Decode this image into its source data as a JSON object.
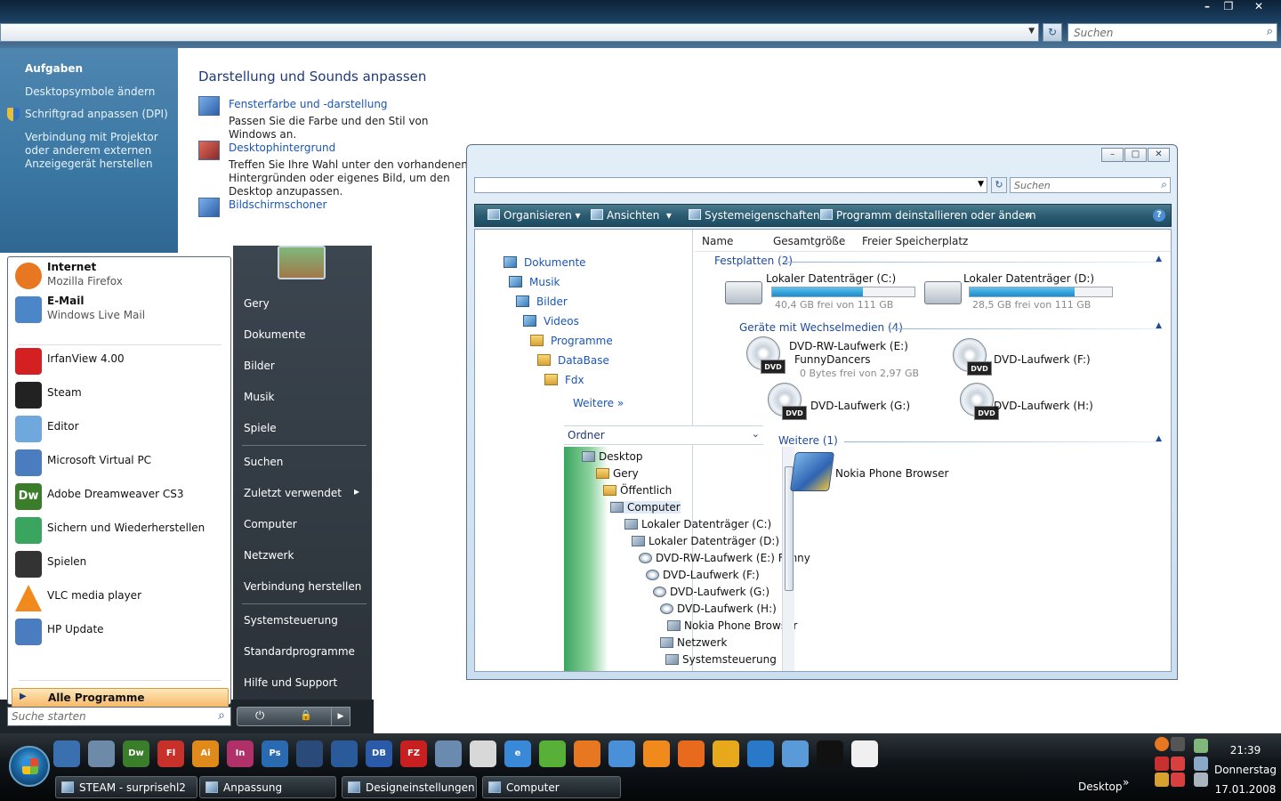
{
  "control_panel": {
    "search_placeholder": "Suchen",
    "window_buttons": {
      "minimize": "–",
      "maximize": "❐",
      "close": "✕"
    },
    "sidebar": {
      "heading": "Aufgaben",
      "links": [
        "Desktopsymbole ändern",
        "Schriftgrad anpassen (DPI)",
        "Verbindung mit Projektor oder anderem externen Anzeigegerät herstellen"
      ]
    },
    "title": "Darstellung und Sounds anpassen",
    "items": [
      {
        "link": "Fensterfarbe und -darstellung",
        "desc": "Passen Sie die Farbe und den Stil von Windows an."
      },
      {
        "link": "Desktophintergrund",
        "desc": "Treffen Sie Ihre Wahl unter den vorhandenen Hintergründen oder eigenes Bild, um den Desktop anzupassen."
      },
      {
        "link": "Bildschirmschoner",
        "desc": ""
      }
    ]
  },
  "explorer": {
    "search_placeholder": "Suchen",
    "toolbar": [
      "Organisieren",
      "Ansichten",
      "Systemeigenschaften",
      "Programm deinstallieren oder ändern"
    ],
    "toolbar_more": "»",
    "help": "?",
    "favorites": [
      "Dokumente",
      "Musik",
      "Bilder",
      "Videos",
      "Programme",
      "DataBase",
      "Fdx"
    ],
    "more_label": "Weitere",
    "more_chevron": "»",
    "folders_label": "Ordner",
    "tree": [
      "Desktop",
      "Gery",
      "Öffentlich",
      "Computer",
      "Lokaler Datenträger (C:)",
      "Lokaler Datenträger (D:)",
      "DVD-RW-Laufwerk (E:) Funny",
      "DVD-Laufwerk (F:)",
      "DVD-Laufwerk (G:)",
      "DVD-Laufwerk (H:)",
      "Nokia Phone Browser",
      "Netzwerk",
      "Systemsteuerung"
    ],
    "columns": [
      "Name",
      "Gesamtgröße",
      "Freier Speicherplatz"
    ],
    "groups": {
      "hdd": "Festplatten (2)",
      "removable": "Geräte mit Wechselmedien (4)",
      "other": "Weitere (1)"
    },
    "hdd": [
      {
        "name": "Lokaler Datenträger (C:)",
        "free": "40,4 GB frei von 111 GB",
        "used_fraction": 0.64
      },
      {
        "name": "Lokaler Datenträger (D:)",
        "free": "28,5 GB frei von 111 GB",
        "used_fraction": 0.74
      }
    ],
    "removable": [
      {
        "name": "DVD-RW-Laufwerk (E:)",
        "label": "FunnyDancers",
        "free": "0 Bytes frei von 2,97 GB"
      },
      {
        "name": "DVD-Laufwerk (F:)"
      },
      {
        "name": "DVD-Laufwerk (G:)"
      },
      {
        "name": "DVD-Laufwerk (H:)"
      }
    ],
    "dvd_badge": "DVD",
    "other": [
      {
        "name": "Nokia Phone Browser"
      }
    ]
  },
  "start_menu": {
    "pinned": [
      {
        "title": "Internet",
        "subtitle": "Mozilla Firefox",
        "color": "#e87722"
      },
      {
        "title": "E-Mail",
        "subtitle": "Windows Live Mail",
        "color": "#4a86c8"
      }
    ],
    "recent": [
      {
        "title": "IrfanView 4.00",
        "color": "#d42020"
      },
      {
        "title": "Steam",
        "color": "#222222"
      },
      {
        "title": "Editor",
        "color": "#6fa8dc"
      },
      {
        "title": "Microsoft Virtual PC",
        "color": "#4a7dc0"
      },
      {
        "title": "Adobe Dreamweaver CS3",
        "color": "#3a7d2a",
        "badge": "Dw"
      },
      {
        "title": "Sichern und Wiederherstellen",
        "color": "#3aa55f"
      },
      {
        "title": "Spielen",
        "color": "#333333"
      },
      {
        "title": "VLC media player",
        "color": "#f08a1c"
      },
      {
        "title": "HP Update",
        "color": "#4a7dc0"
      }
    ],
    "all_programs": "Alle Programme",
    "all_programs_arrow": "▶",
    "search_placeholder": "Suche starten",
    "right": [
      "Gery",
      "Dokumente",
      "Bilder",
      "Musik",
      "Spiele",
      "Suchen",
      "Zuletzt verwendet",
      "Computer",
      "Netzwerk",
      "Verbindung herstellen",
      "Systemsteuerung",
      "Standardprogramme",
      "Hilfe und Support"
    ],
    "recent_arrow": "▸",
    "power_icon": "⏻",
    "lock_icon": "🔒",
    "more_arrow": "▶"
  },
  "taskbar": {
    "quicklaunch": [
      {
        "label": "",
        "color": "#3a6fb0"
      },
      {
        "label": "",
        "color": "#6d8aa8"
      },
      {
        "label": "Dw",
        "color": "#3a7d2a"
      },
      {
        "label": "Fl",
        "color": "#c8302a"
      },
      {
        "label": "Ai",
        "color": "#e08a1c"
      },
      {
        "label": "In",
        "color": "#b0306a"
      },
      {
        "label": "Ps",
        "color": "#2a6ab0"
      },
      {
        "label": "",
        "color": "#2a4a7a"
      },
      {
        "label": "",
        "color": "#2a5a9a"
      },
      {
        "label": "DB",
        "color": "#2a5aa8"
      },
      {
        "label": "FZ",
        "color": "#c82020"
      },
      {
        "label": "",
        "color": "#6a8ab0"
      },
      {
        "label": "",
        "color": "#d8d8d8"
      },
      {
        "label": "e",
        "color": "#3a88d8"
      },
      {
        "label": "",
        "color": "#58b038"
      },
      {
        "label": "",
        "color": "#e87722"
      },
      {
        "label": "",
        "color": "#4a90d8"
      },
      {
        "label": "",
        "color": "#f08a1c"
      },
      {
        "label": "",
        "color": "#e86a1c"
      },
      {
        "label": "",
        "color": "#e8a81c"
      },
      {
        "label": "",
        "color": "#2a78c8"
      },
      {
        "label": "",
        "color": "#5a9ad8"
      },
      {
        "label": "",
        "color": "#111111"
      },
      {
        "label": "",
        "color": "#f0f0f0"
      }
    ],
    "tasks": [
      "STEAM - surprisehl2",
      "Anpassung",
      "Designeinstellungen",
      "Computer"
    ],
    "desktop": "Desktop",
    "chevron": "»",
    "time": "21:39",
    "day": "Donnerstag",
    "date": "17.01.2008"
  }
}
